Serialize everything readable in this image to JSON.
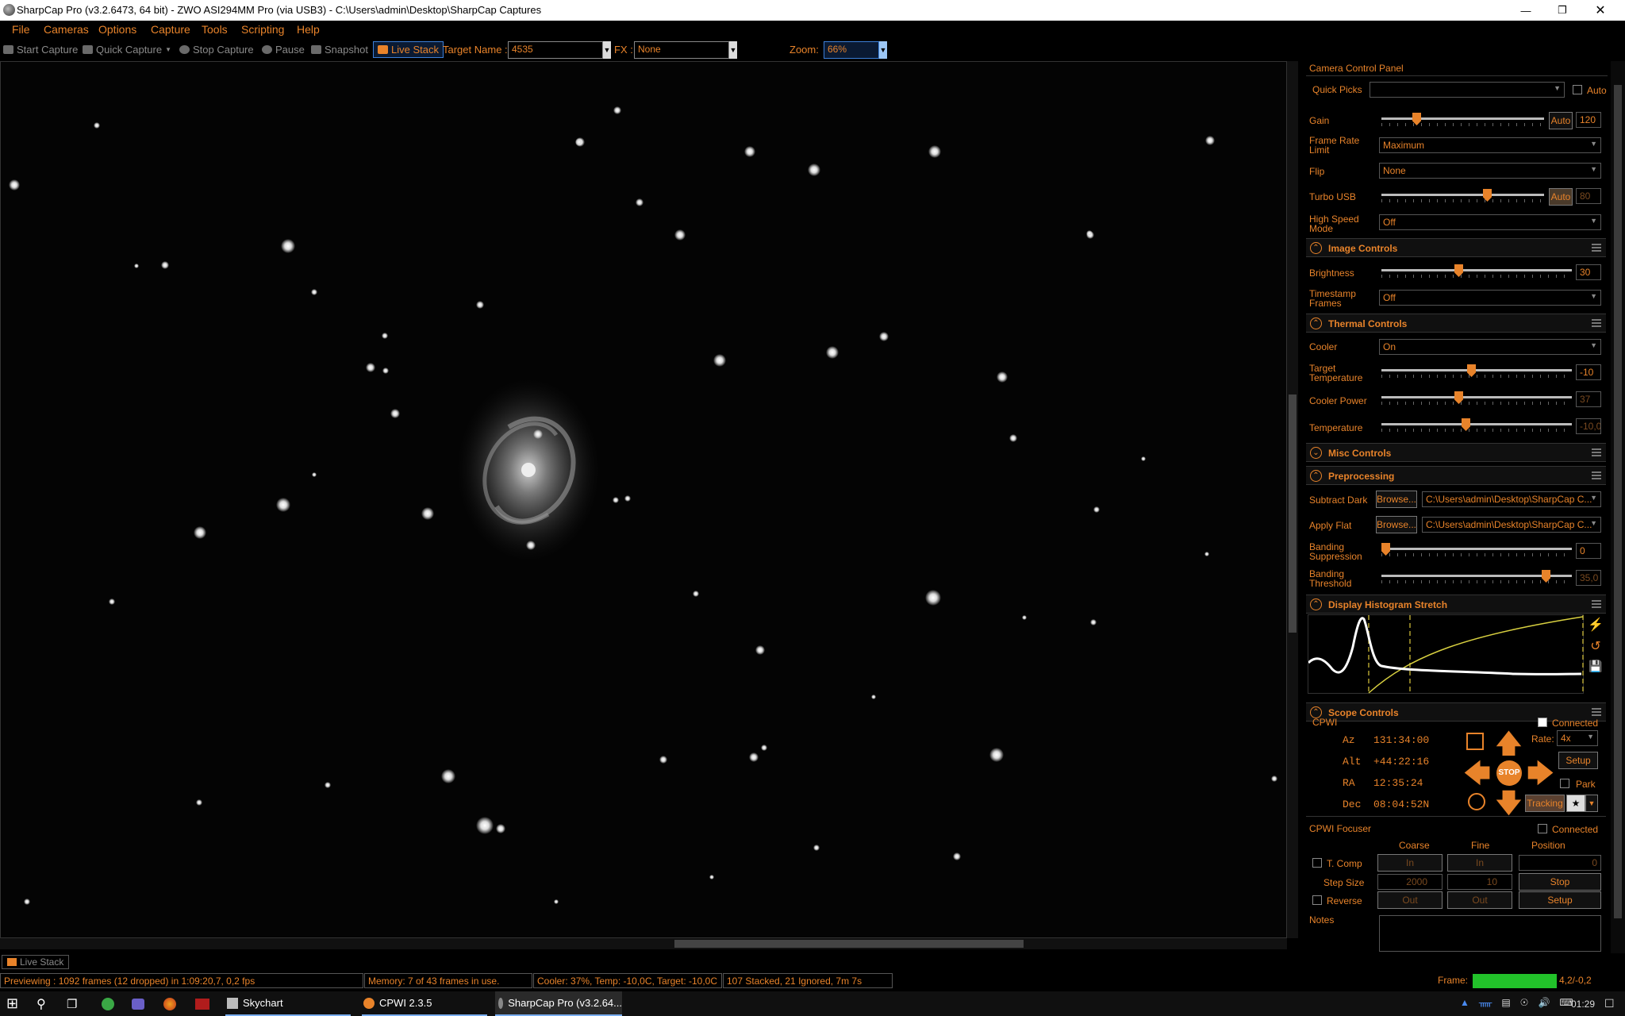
{
  "window": {
    "title": "SharpCap Pro (v3.2.6473, 64 bit) - ZWO ASI294MM Pro (via USB3) - C:\\Users\\admin\\Desktop\\SharpCap Captures"
  },
  "menu": [
    "File",
    "Cameras",
    "Options",
    "Capture",
    "Tools",
    "Scripting",
    "Help"
  ],
  "toolbar": {
    "start_capture": "Start Capture",
    "quick_capture": "Quick Capture",
    "stop_capture": "Stop Capture",
    "pause": "Pause",
    "snapshot": "Snapshot",
    "live_stack": "Live Stack",
    "target_name_label": "Target Name :",
    "target_name_value": "4535",
    "fx_label": "FX :",
    "fx_value": "None",
    "zoom_label": "Zoom:",
    "zoom_value": "66%"
  },
  "panel": {
    "title": "Camera Control Panel",
    "quick_picks_label": "Quick Picks",
    "quick_picks_value": "",
    "auto_label": "Auto",
    "gain": {
      "label": "Gain",
      "auto": "Auto",
      "value": "120",
      "level": 0.2
    },
    "frame_rate": {
      "label1": "Frame Rate",
      "label2": "Limit",
      "value": "Maximum"
    },
    "flip": {
      "label": "Flip",
      "value": "None"
    },
    "turbo_usb": {
      "label": "Turbo USB",
      "auto": "Auto",
      "value": "80",
      "level": 0.66
    },
    "high_speed": {
      "label1": "High Speed",
      "label2": "Mode",
      "value": "Off"
    },
    "image_controls": {
      "title": "Image Controls",
      "brightness_label": "Brightness",
      "brightness_value": "30",
      "brightness_level": 0.4,
      "timestamp_label1": "Timestamp",
      "timestamp_label2": "Frames",
      "timestamp_value": "Off"
    },
    "thermal": {
      "title": "Thermal Controls",
      "cooler_label": "Cooler",
      "cooler_value": "On",
      "target_label1": "Target",
      "target_label2": "Temperature",
      "target_value": "-10",
      "target_level": 0.47,
      "power_label": "Cooler Power",
      "power_value": "37",
      "power_level": 0.4,
      "temp_label": "Temperature",
      "temp_value": "-10,0",
      "temp_level": 0.44
    },
    "misc": {
      "title": "Misc Controls"
    },
    "preprocessing": {
      "title": "Preprocessing",
      "dark_label": "Subtract Dark",
      "browse": "Browse...",
      "dark_value": "C:\\Users\\admin\\Desktop\\SharpCap C...",
      "flat_label": "Apply Flat",
      "flat_value": "C:\\Users\\admin\\Desktop\\SharpCap C...",
      "band_supp_label1": "Banding",
      "band_supp_label2": "Suppression",
      "band_supp_value": "0",
      "band_supp_level": 0.0,
      "band_thr_label1": "Banding",
      "band_thr_label2": "Threshold",
      "band_thr_value": "35,0",
      "band_thr_level": 0.88
    },
    "histogram": {
      "title": "Display Histogram Stretch"
    },
    "scope": {
      "title": "Scope Controls",
      "device": "CPWI",
      "connected": "Connected",
      "az": "Az   131:34:00",
      "alt": "Alt  +44:22:16",
      "ra": "RA   12:35:24",
      "dec": "Dec  08:04:52N",
      "rate_label": "Rate:",
      "rate_value": "4x",
      "setup": "Setup",
      "park": "Park",
      "tracking": "Tracking",
      "stop": "STOP"
    },
    "focuser": {
      "title": "CPWI Focuser",
      "connected": "Connected",
      "coarse": "Coarse",
      "fine": "Fine",
      "position": "Position",
      "tcomp": "T. Comp",
      "in": "In",
      "position_value": "0",
      "step_size": "Step Size",
      "coarse_step": "2000",
      "fine_step": "10",
      "stop": "Stop",
      "reverse": "Reverse",
      "out": "Out",
      "setup": "Setup"
    },
    "notes": "Notes"
  },
  "live_stack_tab": "Live Stack",
  "status": {
    "previewing": "Previewing : 1092 frames (12 dropped) in 1:09:20,7, 0,2 fps",
    "memory": "Memory: 7 of 43 frames in use.",
    "cooler": "Cooler: 37%, Temp: -10,0C, Target: -10,0C",
    "stacked": "107 Stacked, 21 Ignored, 7m 7s",
    "frame_label": "Frame:",
    "frame_value": "4,2/-0,2"
  },
  "taskbar": {
    "items": [
      "Skychart",
      "CPWI 2.3.5",
      "SharpCap Pro (v3.2.64..."
    ],
    "time": "01:29"
  },
  "colors": {
    "accent": "#e8832a",
    "background": "#000000",
    "highlight": "#1e90ff",
    "frame_bar": "#22c22a"
  }
}
